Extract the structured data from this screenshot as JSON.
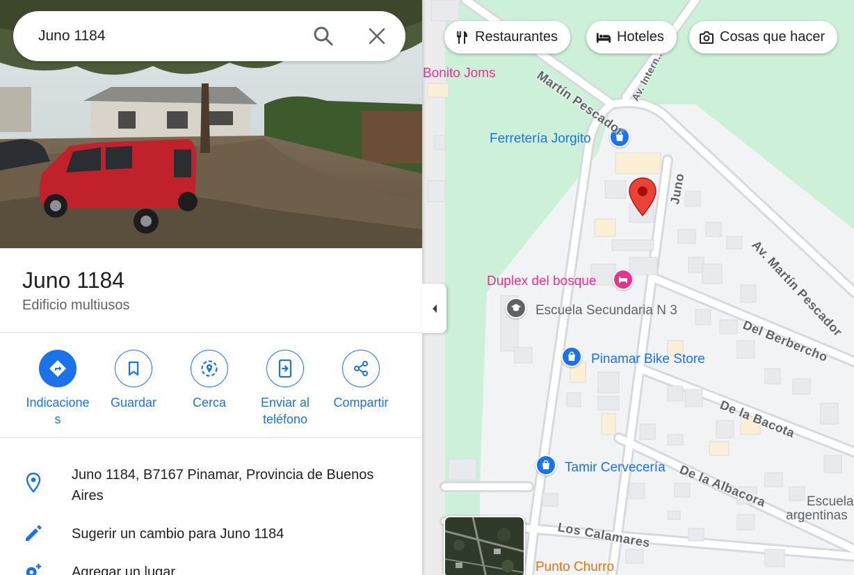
{
  "search": {
    "value": "Juno 1184"
  },
  "place": {
    "title": "Juno 1184",
    "category": "Edificio multiusos"
  },
  "actions": [
    {
      "label": "Indicacione\ns",
      "icon": "directions-icon"
    },
    {
      "label": "Guardar",
      "icon": "bookmark-icon"
    },
    {
      "label": "Cerca",
      "icon": "nearby-icon"
    },
    {
      "label": "Enviar al\nteléfono",
      "icon": "send-to-phone-icon"
    },
    {
      "label": "Compartir",
      "icon": "share-icon"
    }
  ],
  "info": {
    "address": "Juno 1184, B7167 Pinamar, Provincia de Buenos Aires",
    "suggest_edit": "Sugerir un cambio para Juno 1184",
    "add_place": "Agregar un lugar"
  },
  "chips": {
    "restaurants": "Restaurantes",
    "hotels": "Hoteles",
    "things_to_do": "Cosas que hacer"
  },
  "map": {
    "pois": {
      "bonito_joms": "Bonito Joms",
      "ferreteria": "Ferretería Jorgito",
      "duplex": "Duplex del bosque",
      "escuela_sec": "Escuela Secundaria N 3",
      "bike_store": "Pinamar Bike Store",
      "tamir": "Tamir Cervecería",
      "escuela_arg_1": "Escuela",
      "escuela_arg_2": "argentinas",
      "punto_churro": "Punto Churro"
    },
    "streets": {
      "martin_pescador_top": "Martín Pescador",
      "av_internal": "Av. Intern...os",
      "juno": "Juno",
      "av_martin_pescador": "Av. Martín Pescador",
      "del_berbercho": "Del Berbercho",
      "de_la_bacota": "De la Bacota",
      "de_la_albacora": "De la Albacora",
      "los_calamares": "Los Calamares"
    },
    "colors": {
      "park_green": "#cdf0d9",
      "road": "#dadce0",
      "poi_blue": "#1a73e8",
      "poi_pink": "#e8338b",
      "poi_gray": "#5f6368",
      "poi_orange": "#e8710a",
      "pin_red": "#ea4335"
    }
  }
}
